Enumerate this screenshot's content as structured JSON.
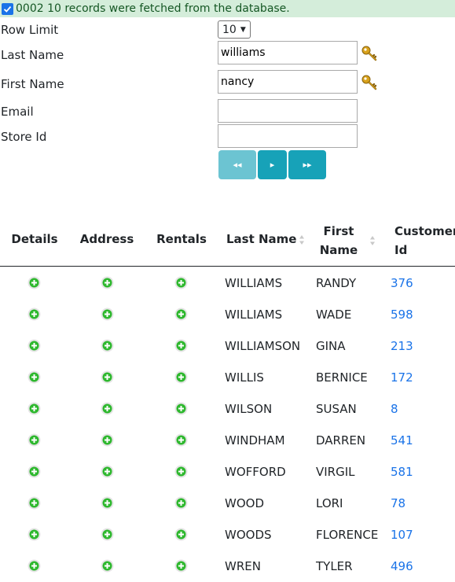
{
  "status": {
    "message": "0002 10 records were fetched from the database."
  },
  "form": {
    "row_limit_label": "Row Limit",
    "row_limit_value": "10",
    "last_name_label": "Last Name",
    "last_name_value": "williams",
    "first_name_label": "First Name",
    "first_name_value": "nancy",
    "email_label": "Email",
    "email_value": "",
    "store_id_label": "Store Id",
    "store_id_value": ""
  },
  "pager": {
    "first_label": "◂◂",
    "next_label": "▸",
    "last_label": "▸▸"
  },
  "table": {
    "headers": {
      "details": "Details",
      "address": "Address",
      "rentals": "Rentals",
      "last_name": "Last Name",
      "first_name": "First Name",
      "customer_id": "Customer Id"
    },
    "rows": [
      {
        "last_name": "WILLIAMS",
        "first_name": "RANDY",
        "customer_id": "376"
      },
      {
        "last_name": "WILLIAMS",
        "first_name": "WADE",
        "customer_id": "598"
      },
      {
        "last_name": "WILLIAMSON",
        "first_name": "GINA",
        "customer_id": "213"
      },
      {
        "last_name": "WILLIS",
        "first_name": "BERNICE",
        "customer_id": "172"
      },
      {
        "last_name": "WILSON",
        "first_name": "SUSAN",
        "customer_id": "8"
      },
      {
        "last_name": "WINDHAM",
        "first_name": "DARREN",
        "customer_id": "541"
      },
      {
        "last_name": "WOFFORD",
        "first_name": "VIRGIL",
        "customer_id": "581"
      },
      {
        "last_name": "WOOD",
        "first_name": "LORI",
        "customer_id": "78"
      },
      {
        "last_name": "WOODS",
        "first_name": "FLORENCE",
        "customer_id": "107"
      },
      {
        "last_name": "WREN",
        "first_name": "TYLER",
        "customer_id": "496"
      }
    ]
  },
  "colors": {
    "success_bg": "#d4edda",
    "success_text": "#155724",
    "link": "#1a73e8",
    "button": "#17a2b8",
    "expand_icon": "#2eb82e"
  }
}
